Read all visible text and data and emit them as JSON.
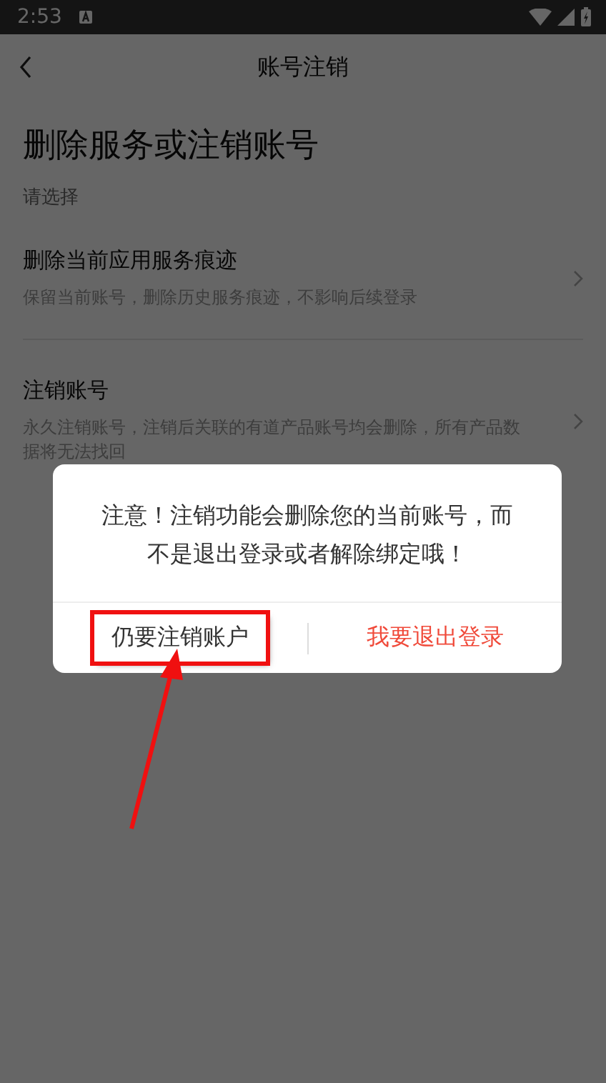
{
  "status_bar": {
    "time": "2:53"
  },
  "nav": {
    "title": "账号注销"
  },
  "heading": "删除服务或注销账号",
  "subheading": "请选择",
  "options": [
    {
      "title": "删除当前应用服务痕迹",
      "description": "保留当前账号，删除历史服务痕迹，不影响后续登录"
    },
    {
      "title": "注销账号",
      "description": "永久注销账号，注销后关联的有道产品账号均会删除，所有产品数据将无法找回"
    }
  ],
  "dialog": {
    "message": "注意！注销功能会删除您的当前账号，而不是退出登录或者解除绑定哦！",
    "buttons": [
      {
        "label": "仍要注销账户",
        "kind": "neutral",
        "highlighted": true
      },
      {
        "label": "我要退出登录",
        "kind": "primary",
        "highlighted": false
      }
    ]
  }
}
